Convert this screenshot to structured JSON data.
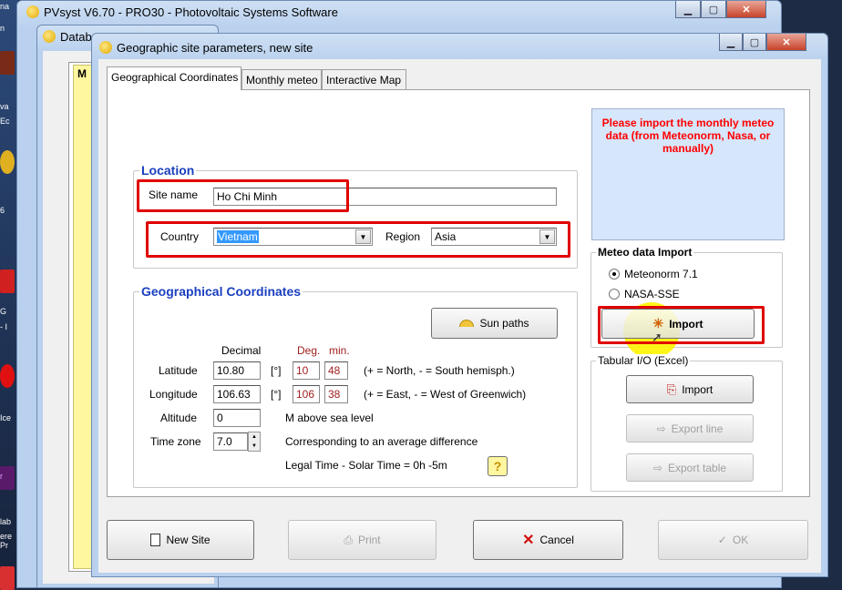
{
  "desktop": {
    "snippets": [
      "na",
      "n",
      "va",
      "Ec",
      "6",
      "G",
      "- I",
      "Ice",
      "r",
      "lab",
      "ere Pr"
    ]
  },
  "back_window": {
    "title": "PVsyst V6.70 - PRO30 - Photovoltaic Systems Software"
  },
  "db_window": {
    "title": "Datab",
    "side_letter": "M"
  },
  "dialog": {
    "title": "Geographic site parameters, new site",
    "tabs": [
      {
        "label": "Geographical Coordinates",
        "active": true
      },
      {
        "label": "Monthly meteo",
        "active": false
      },
      {
        "label": "Interactive Map",
        "active": false
      }
    ],
    "notice": "Please import the monthly meteo data (from Meteonorm, Nasa, or manually)",
    "location": {
      "title": "Location",
      "site_name_label": "Site name",
      "site_name": "Ho Chi Minh",
      "country_label": "Country",
      "country": "Vietnam",
      "region_label": "Region",
      "region": "Asia"
    },
    "geo": {
      "title": "Geographical Coordinates",
      "sun_paths_label": "Sun paths",
      "col_decimal": "Decimal",
      "col_deg": "Deg.",
      "col_min": "min.",
      "latitude_label": "Latitude",
      "latitude": "10.80",
      "lat_deg": "10",
      "lat_min": "48",
      "lat_hint": "(+ = North,  - = South hemisph.)",
      "longitude_label": "Longitude",
      "longitude": "106.63",
      "lon_deg": "106",
      "lon_min": "38",
      "lon_hint": "(+ = East, - = West of Greenwich)",
      "unit_deg": "[°]",
      "altitude_label": "Altitude",
      "altitude": "0",
      "altitude_hint": "M above sea level",
      "timezone_label": "Time zone",
      "timezone": "7.0",
      "timezone_hint": "Corresponding to an average difference",
      "legal_time": "Legal Time - Solar Time =   0h -5m",
      "help": "?"
    },
    "meteo_import": {
      "title": "Meteo data Import",
      "options": [
        "Meteonorm 7.1",
        "NASA-SSE"
      ],
      "selected": "Meteonorm 7.1",
      "import_label": "Import"
    },
    "tabular": {
      "title": "Tabular I/O (Excel)",
      "import_label": "Import",
      "export_line_label": "Export line",
      "export_table_label": "Export table"
    },
    "buttons": {
      "new_site": "New Site",
      "print": "Print",
      "cancel": "Cancel",
      "ok": "OK"
    }
  },
  "colors": {
    "accent_blue": "#1a3fbf",
    "notice_red": "#ff0000",
    "notice_bg": "#d6e6fb",
    "deg_red": "#a02020",
    "highlight": "#e00000"
  }
}
